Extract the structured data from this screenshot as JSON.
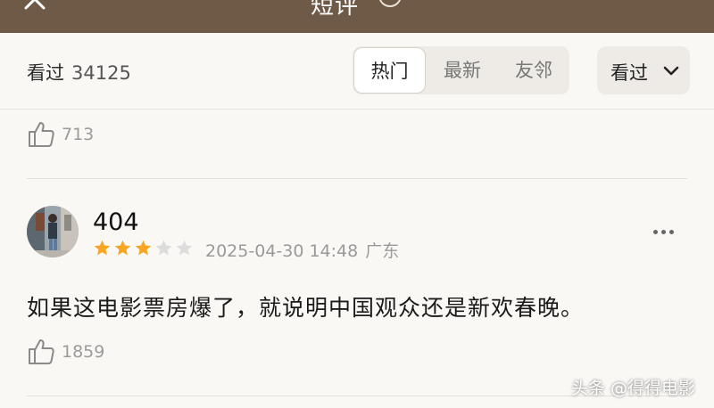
{
  "header": {
    "title": "短评",
    "back_icon": "back-arrow-icon",
    "help_icon": "help-icon"
  },
  "filter": {
    "label": "看过",
    "count": "34125",
    "tabs": [
      {
        "label": "热门",
        "active": true
      },
      {
        "label": "最新",
        "active": false
      },
      {
        "label": "友邻",
        "active": false
      }
    ],
    "dropdown_label": "看过",
    "dropdown_icon": "chevron-down-icon"
  },
  "comments": [
    {
      "likes": "713"
    },
    {
      "username": "404",
      "rating": 3,
      "max_rating": 5,
      "date": "2025-04-30 14:48",
      "location": "广东",
      "text": "如果这电影票房爆了，就说明中国观众还是新欢春晚。",
      "likes": "1859"
    }
  ],
  "watermark": "头条 @得得电影",
  "colors": {
    "header_bg": "#6e5a47",
    "page_bg": "#faf8f5",
    "star_filled": "#f6a623",
    "star_empty": "#dcdcdc"
  }
}
